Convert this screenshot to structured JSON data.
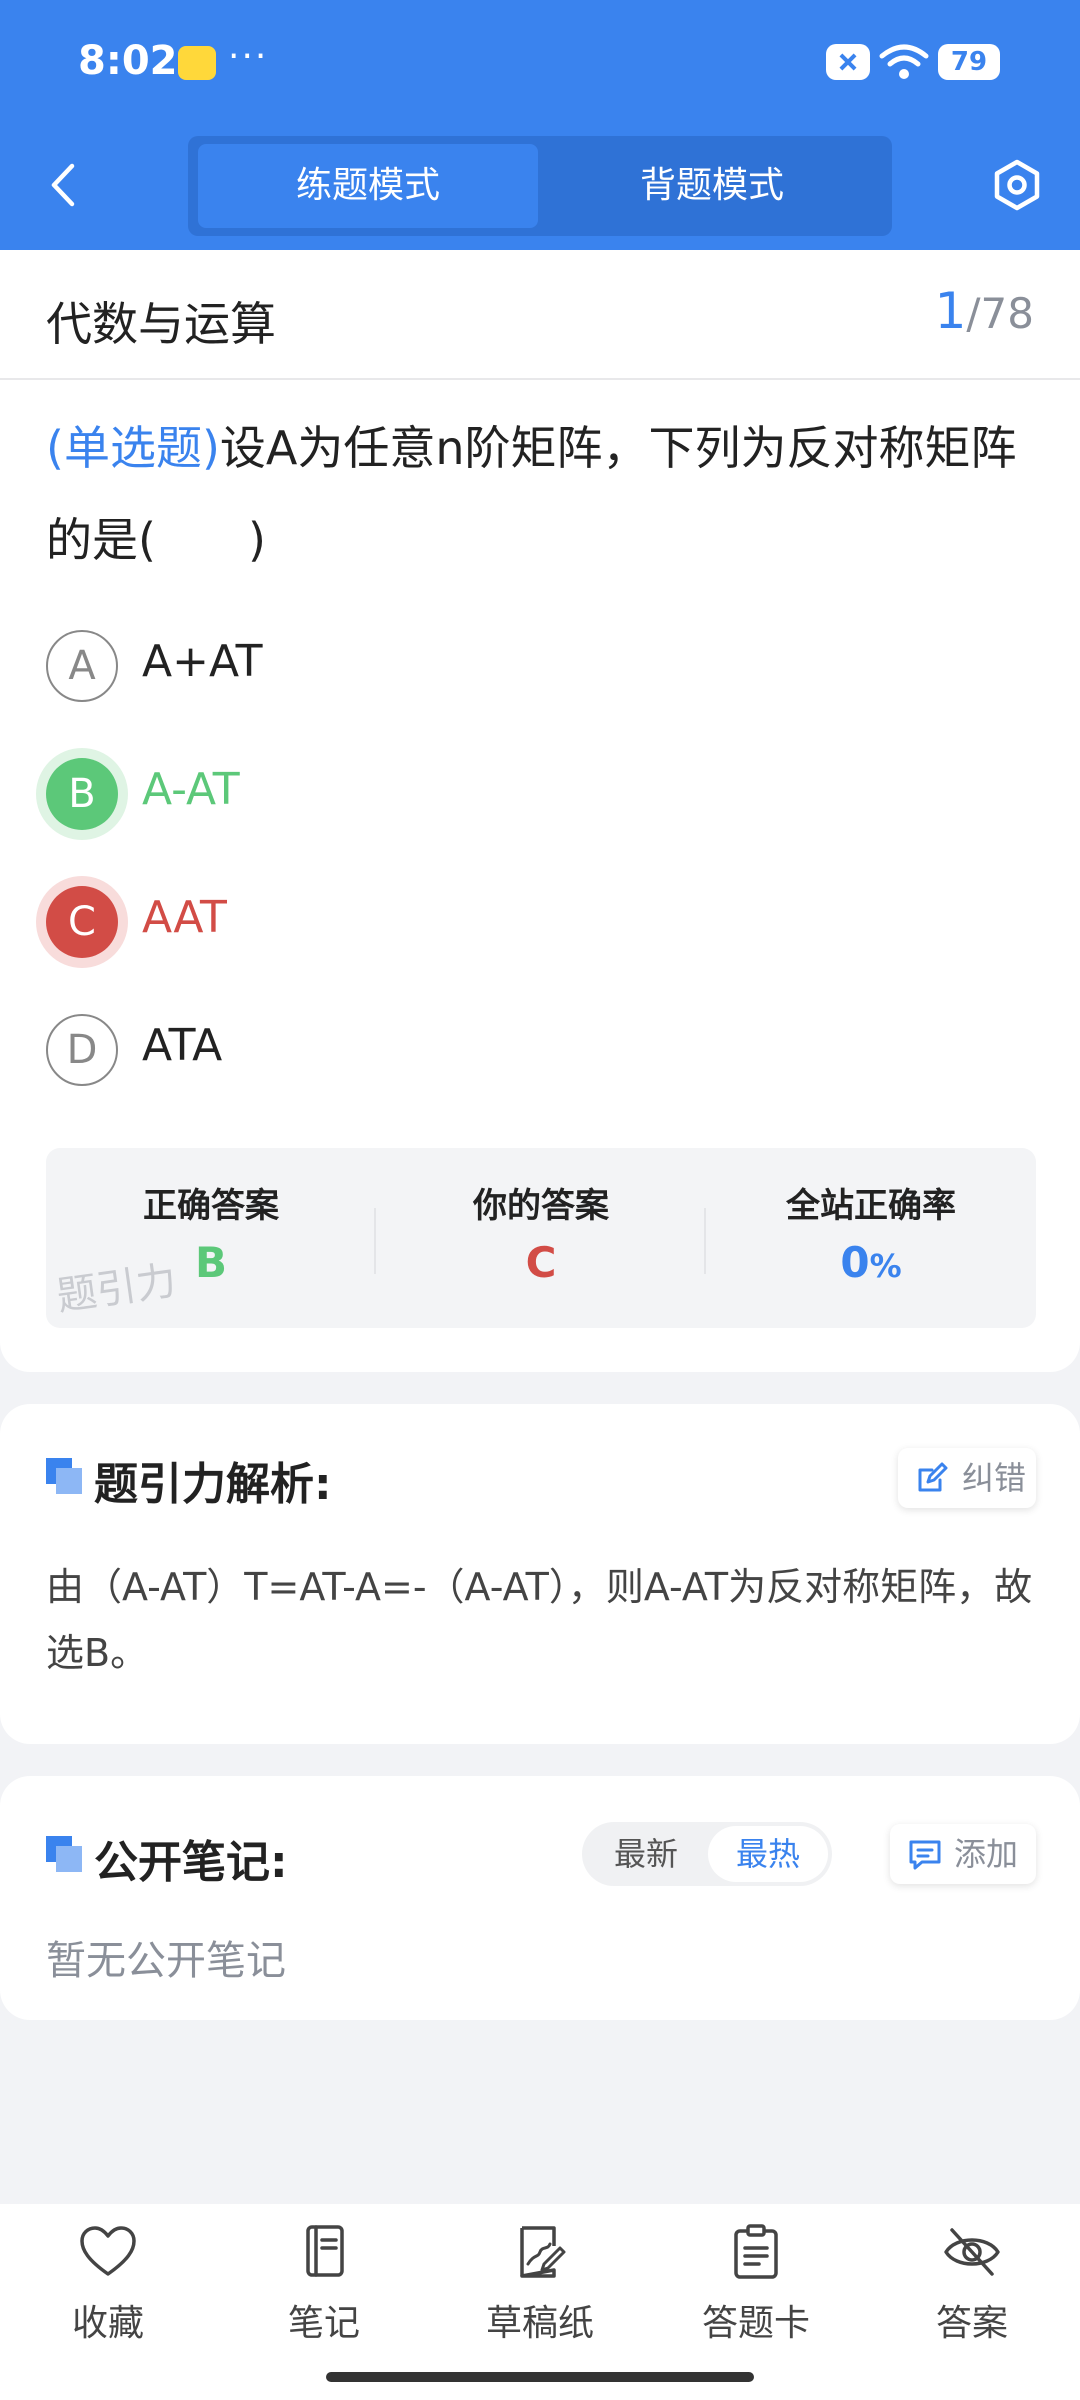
{
  "status_bar": {
    "time": "8:02",
    "dots": "···",
    "battery": "79"
  },
  "header": {
    "tabs": [
      {
        "label": "练题模式",
        "active": true
      },
      {
        "label": "背题模式",
        "active": false
      }
    ]
  },
  "chapter": {
    "title": "代数与运算",
    "current": "1",
    "separator": "/",
    "total": "78"
  },
  "question": {
    "type": "(单选题)",
    "text": "设A为任意n阶矩阵，下列为反对称矩阵的是(　　)"
  },
  "options": [
    {
      "letter": "A",
      "text": "A+AT",
      "state": "normal"
    },
    {
      "letter": "B",
      "text": "A-AT",
      "state": "correct"
    },
    {
      "letter": "C",
      "text": "AAT",
      "state": "wrong"
    },
    {
      "letter": "D",
      "text": "ATA",
      "state": "normal"
    }
  ],
  "answer_summary": {
    "correct_label": "正确答案",
    "correct_value": "B",
    "yours_label": "你的答案",
    "yours_value": "C",
    "rate_label": "全站正确率",
    "rate_value": "0",
    "rate_unit": "%",
    "watermark": "题引力"
  },
  "analysis": {
    "title": "题引力解析:",
    "correct_btn": "纠错",
    "text": "由（A-AT）T=AT-A=-（A-AT），则A-AT为反对称矩阵，故选B。"
  },
  "notes": {
    "title": "公开笔记:",
    "sort_latest": "最新",
    "sort_hot": "最热",
    "add_btn": "添加",
    "empty": "暂无公开笔记"
  },
  "bottom_nav": [
    {
      "label": "收藏",
      "icon": "heart-icon"
    },
    {
      "label": "笔记",
      "icon": "notebook-icon"
    },
    {
      "label": "草稿纸",
      "icon": "draft-icon"
    },
    {
      "label": "答题卡",
      "icon": "answer-sheet-icon"
    },
    {
      "label": "答案",
      "icon": "eye-off-icon"
    }
  ],
  "colors": {
    "primary": "#3a83ee",
    "correct": "#5cc879",
    "wrong": "#d24c46",
    "muted": "#8a8f99"
  }
}
